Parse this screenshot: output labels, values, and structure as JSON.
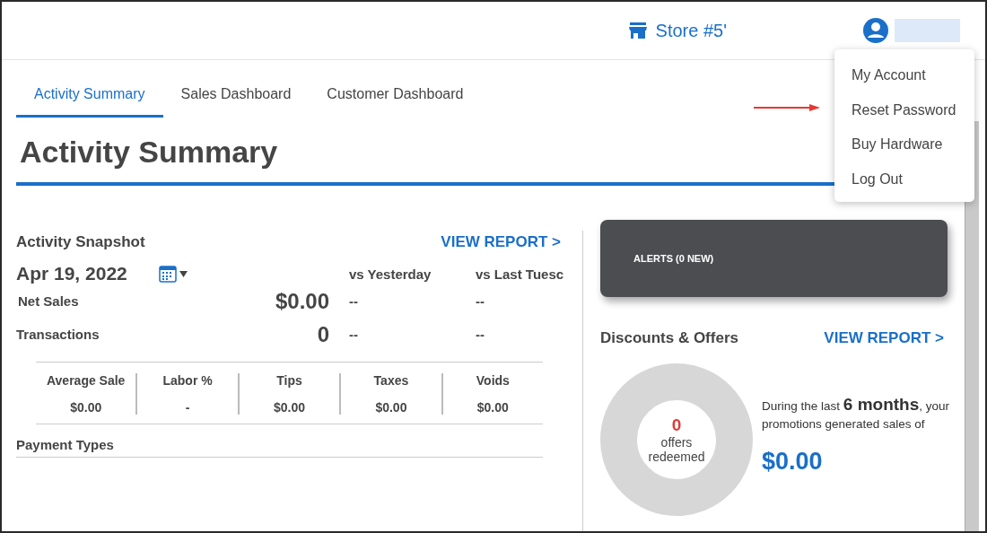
{
  "header": {
    "store": "Store #5'",
    "user_menu": [
      "My Account",
      "Reset Password",
      "Buy Hardware",
      "Log Out"
    ]
  },
  "tabs": [
    {
      "label": "Activity Summary",
      "selected": true
    },
    {
      "label": "Sales Dashboard",
      "selected": false
    },
    {
      "label": "Customer Dashboard",
      "selected": false
    }
  ],
  "page_title": "Activity Summary",
  "snapshot": {
    "title": "Activity Snapshot",
    "view_report": "VIEW REPORT >",
    "date": "Apr 19, 2022",
    "compare_columns": [
      "vs Yesterday",
      "vs Last Tuesc"
    ],
    "metrics": [
      {
        "label": "Net Sales",
        "value": "$0.00",
        "vs": [
          "--",
          "--"
        ]
      },
      {
        "label": "Transactions",
        "value": "0",
        "vs": [
          "--",
          "--"
        ]
      }
    ],
    "stats": [
      {
        "label": "Average Sale",
        "value": "$0.00"
      },
      {
        "label": "Labor %",
        "value": "-"
      },
      {
        "label": "Tips",
        "value": "$0.00"
      },
      {
        "label": "Taxes",
        "value": "$0.00"
      },
      {
        "label": "Voids",
        "value": "$0.00"
      }
    ],
    "payment_types": "Payment Types"
  },
  "alerts": {
    "title": "ALERTS (0 NEW)"
  },
  "discounts": {
    "title": "Discounts & Offers",
    "view_report": "VIEW REPORT >",
    "count": "0",
    "count_label": "offers redeemed",
    "summary": "During the last **6 months**, your promotions generated sales of",
    "amount": "$0.00"
  }
}
